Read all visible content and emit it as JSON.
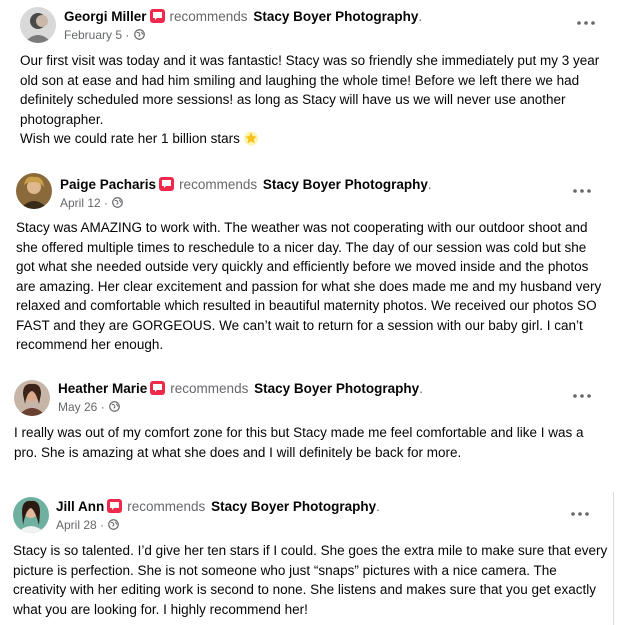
{
  "recommend_word": "recommends",
  "page_name": "Stacy Boyer Photography",
  "dot": ".",
  "meta_sep": " · ",
  "icons": {
    "recommend": "recommend-badge-icon",
    "globe": "globe-icon",
    "more": "more-options-icon",
    "star": "glowing-star-emoji"
  },
  "colors": {
    "recommend_badge": "#f02849",
    "meta_gray": "#65676b"
  },
  "reviews": [
    {
      "author": "Georgi Miller",
      "date": "February 5",
      "text": "Our first visit was today and it was fantastic! Stacy was so friendly she immediately put my 3 year\nold son at ease and had him smiling and laughing the whole time! Before we left there we had\ndefinitely scheduled more sessions! as long as Stacy will have us we will never use another\nphotographer.\nWish we could rate her 1 billion stars"
    },
    {
      "author": "Paige Pacharis",
      "date": "April 12",
      "text": "Stacy was AMAZING to work with. The weather was not cooperating with our outdoor shoot and\nshe offered multiple times to reschedule to a nicer day. The day of our session was cold but she\ngot what she needed outside very quickly and efficiently before we moved inside and the photos\nare amazing. Her clear excitement and passion for what she does made me and my husband very\nrelaxed and comfortable which resulted in beautiful maternity photos. We received our photos SO\nFAST and they are GORGEOUS. We can’t wait to return for a session with our baby girl. I can’t\nrecommend her enough."
    },
    {
      "author": "Heather Marie",
      "date": "May 26",
      "text": "I really was out of my comfort zone for this but Stacy made me feel comfortable and like I was a\npro. She is amazing at what she does and I will definitely be back for more."
    },
    {
      "author": "Jill Ann",
      "date": "April 28",
      "text": "Stacy is so talented. I’d give her ten stars if I could. She goes the extra mile to make sure that every\npicture is perfection. She is not someone who just “snaps” pictures with a nice camera. The\ncreativity with her editing work is second to none.  She listens and makes sure that you get exactly\nwhat you are looking for. I highly recommend her!"
    }
  ]
}
